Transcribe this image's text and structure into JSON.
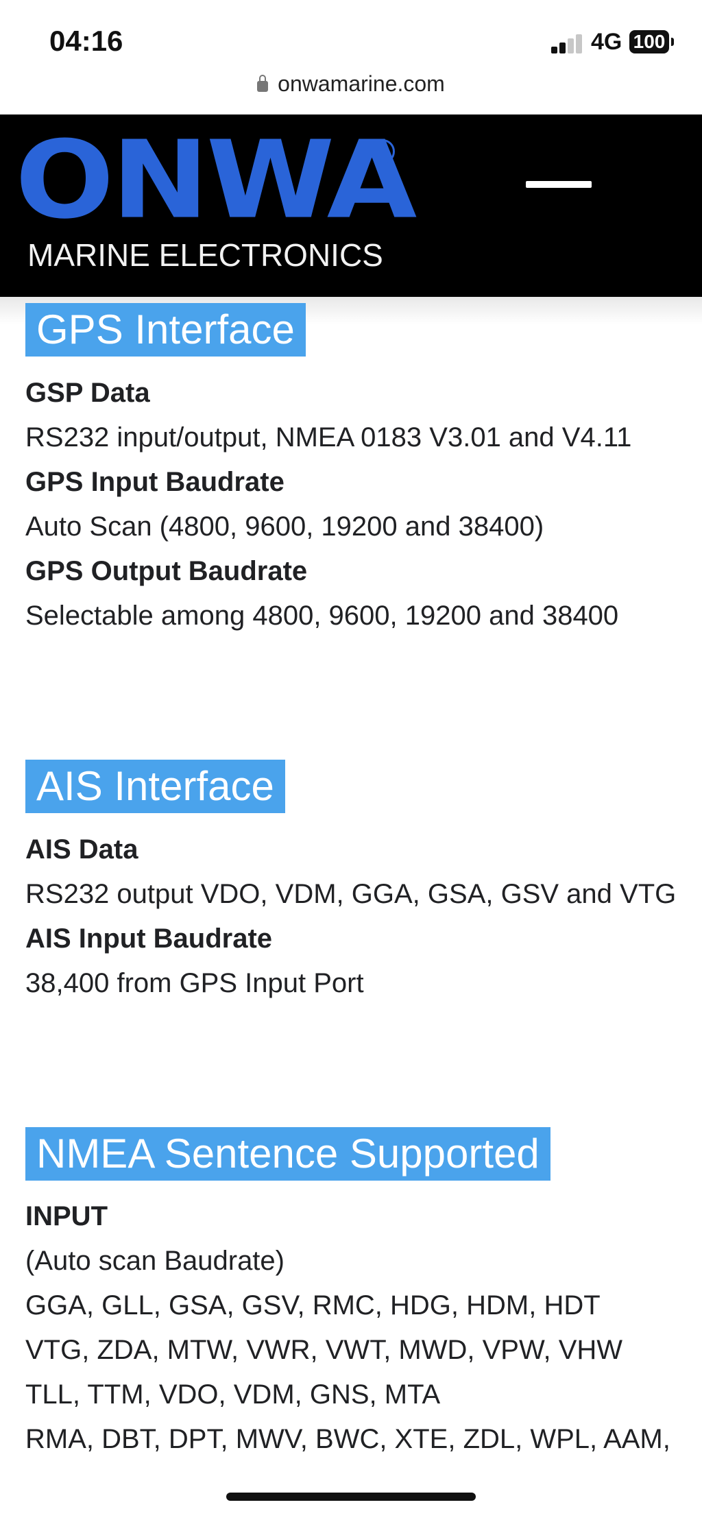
{
  "status_bar": {
    "time": "04:16",
    "network": "4G",
    "battery": "100"
  },
  "browser": {
    "url": "onwamarine.com"
  },
  "header": {
    "logo_word": "ONWA",
    "logo_reg": "R",
    "logo_sub": "MARINE ELECTRONICS"
  },
  "gps": {
    "title": "GPS Interface",
    "items": [
      {
        "label": "GSP Data",
        "value": "RS232 input/output, NMEA 0183 V3.01 and V4.11"
      },
      {
        "label": "GPS Input Baudrate",
        "value": "Auto Scan (4800, 9600, 19200 and 38400)"
      },
      {
        "label": "GPS Output Baudrate",
        "value": "Selectable among 4800, 9600, 19200 and 38400"
      }
    ]
  },
  "ais": {
    "title": "AIS Interface",
    "items": [
      {
        "label": "AIS Data",
        "value": "RS232 output VDO, VDM, GGA, GSA, GSV and VTG"
      },
      {
        "label": "AIS Input Baudrate",
        "value": "38,400 from GPS Input Port"
      }
    ]
  },
  "nmea": {
    "title": "NMEA Sentence Supported",
    "input_label": "INPUT",
    "lines": [
      "(Auto scan Baudrate)",
      "GGA, GLL, GSA, GSV, RMC, HDG, HDM, HDT",
      "VTG, ZDA, MTW, VWR, VWT, MWD, VPW, VHW",
      "TLL, TTM, VDO, VDM, GNS, MTA",
      "RMA, DBT, DPT, MWV, BWC, XTE, ZDL, WPL, AAM,"
    ]
  }
}
